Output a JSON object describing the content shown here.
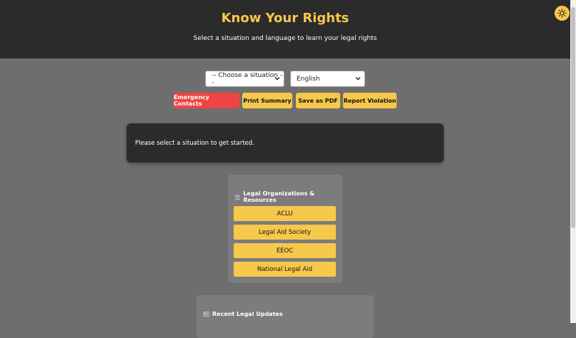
{
  "header": {
    "title": "Know Your Rights",
    "subtitle": "Select a situation and language to learn your legal rights",
    "theme_toggle_icon": "sun-icon"
  },
  "controls": {
    "situation_select": {
      "value": "-- Choose a situation --"
    },
    "language_select": {
      "value": "English"
    }
  },
  "actions": {
    "emergency": "Emergency Contacts",
    "print": "Print Summary",
    "pdf": "Save as PDF",
    "report": "Report Violation"
  },
  "message": "Please select a situation to get started.",
  "organizations": {
    "title": "Legal Organizations & Resources",
    "icon": "building-icon",
    "items": [
      "ACLU",
      "Legal Aid Society",
      "EEOC",
      "National Legal Aid"
    ]
  },
  "updates": {
    "title": "Recent Legal Updates",
    "icon": "newspaper-icon"
  },
  "colors": {
    "accent": "#f6c84b",
    "danger": "#ef4444",
    "header_bg": "#2b2b2b",
    "page_bg": "#6e6e6e",
    "panel_bg": "#7c7c7c"
  }
}
